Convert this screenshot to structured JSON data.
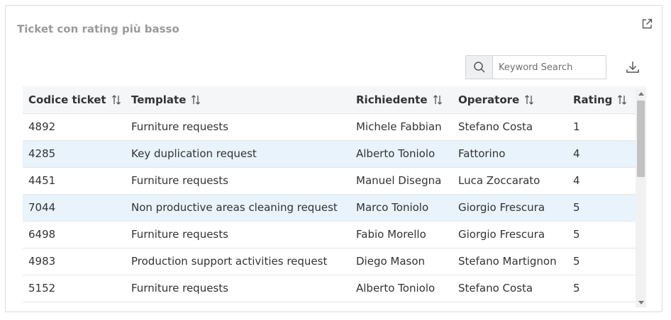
{
  "widget": {
    "title": "Ticket con rating più basso"
  },
  "search": {
    "placeholder": "Keyword Search",
    "value": ""
  },
  "table": {
    "columns": [
      {
        "label": "Codice ticket"
      },
      {
        "label": "Template"
      },
      {
        "label": "Richiedente"
      },
      {
        "label": "Operatore"
      },
      {
        "label": "Rating"
      }
    ],
    "rows": [
      {
        "code": "4892",
        "template": "Furniture requests",
        "requester": "Michele Fabbian",
        "operator": "Stefano Costa",
        "rating": "1"
      },
      {
        "code": "4285",
        "template": "Key duplication request",
        "requester": "Alberto Toniolo",
        "operator": "Fattorino",
        "rating": "4"
      },
      {
        "code": "4451",
        "template": "Furniture requests",
        "requester": "Manuel Disegna",
        "operator": "Luca Zoccarato",
        "rating": "4"
      },
      {
        "code": "7044",
        "template": "Non productive areas cleaning request",
        "requester": "Marco Toniolo",
        "operator": "Giorgio Frescura",
        "rating": "5"
      },
      {
        "code": "6498",
        "template": "Furniture requests",
        "requester": "Fabio Morello",
        "operator": "Giorgio Frescura",
        "rating": "5"
      },
      {
        "code": "4983",
        "template": "Production support activities request",
        "requester": "Diego Mason",
        "operator": "Stefano Martignon",
        "rating": "5"
      },
      {
        "code": "5152",
        "template": "Furniture requests",
        "requester": "Alberto Toniolo",
        "operator": "Stefano Costa",
        "rating": "5"
      }
    ]
  },
  "colors": {
    "title": "#9a9a9a",
    "header_bg": "#f5f6f8",
    "row_highlight": "#e8f3fc",
    "icon": "#555555"
  },
  "icons": {
    "open": "open-external-icon",
    "search": "search-icon",
    "download": "download-icon",
    "sort": "sort-icon"
  }
}
